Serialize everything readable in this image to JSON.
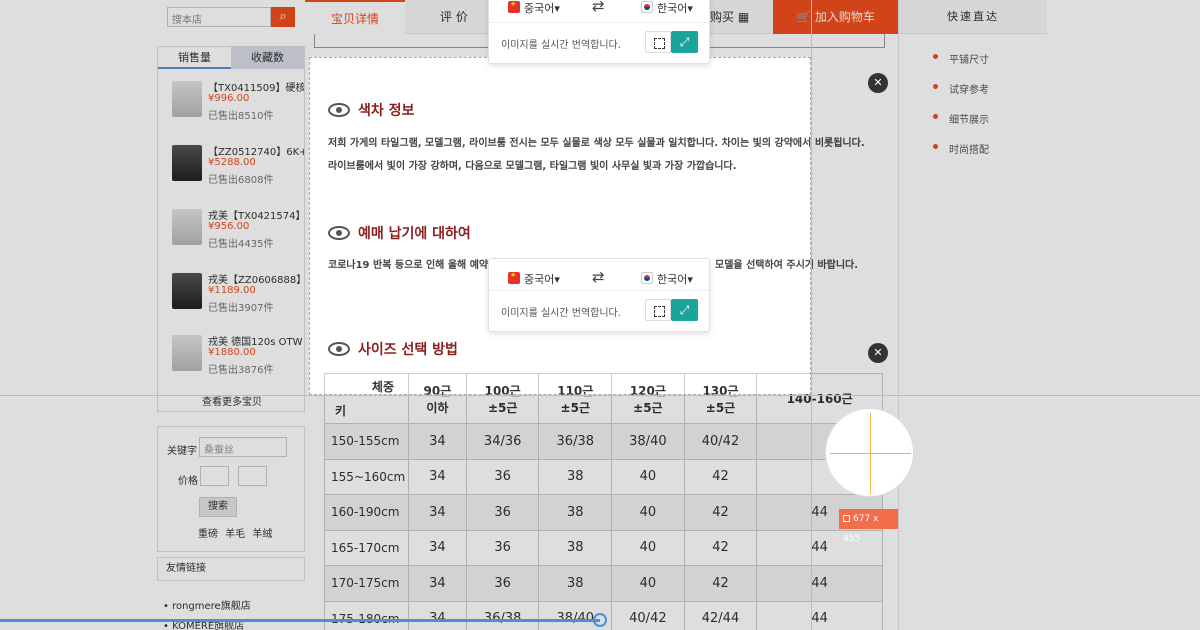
{
  "search": {
    "placeholder": "搜本店",
    "icon": "search-icon"
  },
  "rank": {
    "tabs": [
      "销售量",
      "收藏数"
    ],
    "items": [
      {
        "title": "【TX0411509】硬核",
        "price": "¥996.00",
        "sold": "已售出8510件"
      },
      {
        "title": "【ZZ0512740】6K+",
        "price": "¥5288.00",
        "sold": "已售出6808件"
      },
      {
        "title": "戎美【TX0421574】",
        "price": "¥956.00",
        "sold": "已售出4435件"
      },
      {
        "title": "戎美【ZZ0606888】",
        "price": "¥1189.00",
        "sold": "已售出3907件"
      },
      {
        "title": "戎美 德国120s OTW",
        "price": "¥1880.00",
        "sold": "已售出3876件"
      }
    ],
    "more": "查看更多宝贝"
  },
  "filter": {
    "keyword_label": "关键字",
    "keyword_value": "桑蚕丝",
    "price_label": "价格",
    "button": "搜索",
    "tags": "重磅 羊毛 羊绒"
  },
  "links": {
    "title": "友情链接",
    "items": [
      "rongmere旗舰店",
      "KOMERE旗舰店"
    ]
  },
  "nav": {
    "items": [
      "宝贝详情",
      "评 价",
      "购买"
    ],
    "cart": "加入购物车"
  },
  "right": {
    "title": "快速直达",
    "items": [
      "平铺尺寸",
      "试穿参考",
      "细节展示",
      "时尚搭配"
    ]
  },
  "content": {
    "section1_title": "색차 정보",
    "section1_p1": "저희 가게의 타일그램, 모델그램, 라이브룸 전시는 모두 실물로 색상 모두 실물과 일치합니다. 차이는 빛의 강약에서 비롯됩니다.",
    "section1_p2": "라이브룸에서 빛이 가장 강하며, 다음으로 모델그램, 타일그램 빛이 사무실 빛과 가장 가깝습니다.",
    "section2_title": "예매 납기에 대하여",
    "section2_p1": "코로나19 반복 등으로 인해 올해 예약판매",
    "section2_p1_end": "모델을 선택하여 주시기 바랍니다.",
    "section3_title": "사이즈 선택 방법"
  },
  "size_table": {
    "corner_top": "체중",
    "corner_bottom": "키",
    "headers": [
      [
        "90근",
        "이하"
      ],
      [
        "100근",
        "±5근"
      ],
      [
        "110근",
        "±5근"
      ],
      [
        "120근",
        "±5근"
      ],
      [
        "130근",
        "±5근"
      ],
      [
        "140-160근",
        ""
      ]
    ],
    "rows": [
      {
        "h": "150-155cm",
        "v": [
          "34",
          "34/36",
          "36/38",
          "38/40",
          "40/42",
          ""
        ]
      },
      {
        "h": "155~160cm",
        "v": [
          "34",
          "36",
          "38",
          "40",
          "42",
          ""
        ]
      },
      {
        "h": "160-190cm",
        "v": [
          "34",
          "36",
          "38",
          "40",
          "42",
          "44"
        ]
      },
      {
        "h": "165-170cm",
        "v": [
          "34",
          "36",
          "38",
          "40",
          "42",
          "44"
        ]
      },
      {
        "h": "170-175cm",
        "v": [
          "34",
          "36",
          "38",
          "40",
          "42",
          "44"
        ]
      },
      {
        "h": "175-180cm",
        "v": [
          "34",
          "36/38",
          "38/40",
          "40/42",
          "42/44",
          "44"
        ]
      }
    ]
  },
  "translator": {
    "source_lang": "중국어",
    "target_lang": "한국어",
    "hint": "이미지를 실시간 번역합니다."
  },
  "capture": {
    "size_label": "677 x 455",
    "close": "✕"
  }
}
